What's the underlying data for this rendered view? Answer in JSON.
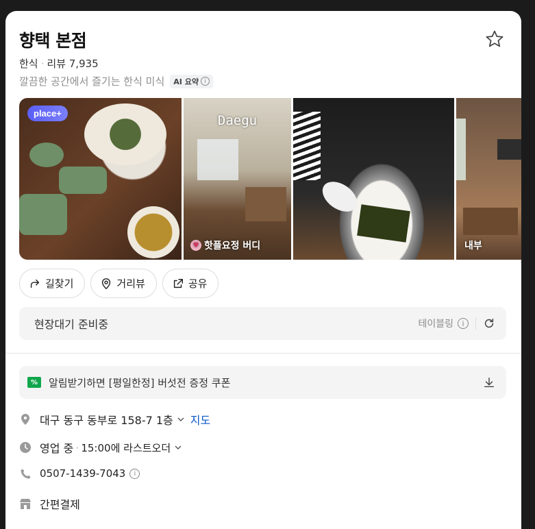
{
  "place": {
    "name": "향택 본점",
    "category": "한식",
    "review_label": "리뷰 7,935",
    "description": "깔끔한 공간에서 즐기는 한식 미식",
    "ai_summary_label": "AI 요약",
    "info_glyph": "i"
  },
  "photos": [
    {
      "badge": "place+"
    },
    {
      "overlay_title": "Daegu",
      "caption": "핫플요정 버디"
    },
    {},
    {
      "caption": "내부"
    }
  ],
  "actions": [
    {
      "label": "길찾기",
      "icon": "directions-icon"
    },
    {
      "label": "거리뷰",
      "icon": "location-pin-icon"
    },
    {
      "label": "공유",
      "icon": "share-icon"
    }
  ],
  "waitlist": {
    "label": "현장대기 준비중",
    "provider": "테이블링",
    "info_glyph": "i"
  },
  "coupon": {
    "icon_text": "%",
    "text": "알림받기하면 [평일한정] 버섯전 증정 쿠폰"
  },
  "details": {
    "address": "대구 동구 동부로 158-7 1층",
    "map_link": "지도",
    "status": "영업 중",
    "last_order": "15:00에 라스트오더",
    "phone": "0507-1439-7043",
    "info_glyph": "i",
    "payment": "간편결제"
  },
  "colors": {
    "accent_link": "#0b57c9",
    "coupon_green": "#11a64c",
    "placeplus_badge": "#5a5ef7"
  }
}
